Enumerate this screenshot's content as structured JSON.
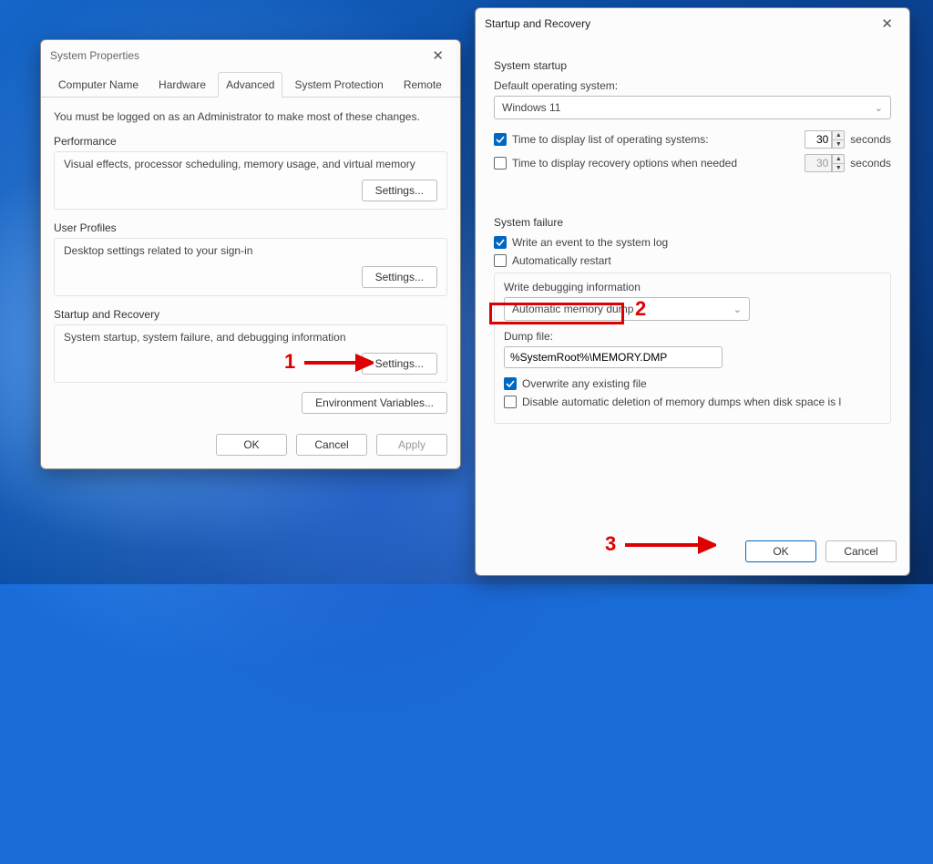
{
  "props": {
    "title": "System Properties",
    "tabs": [
      "Computer Name",
      "Hardware",
      "Advanced",
      "System Protection",
      "Remote"
    ],
    "active_tab": "Advanced",
    "admin_note": "You must be logged on as an Administrator to make most of these changes.",
    "perf": {
      "label": "Performance",
      "desc": "Visual effects, processor scheduling, memory usage, and virtual memory",
      "btn": "Settings..."
    },
    "profiles": {
      "label": "User Profiles",
      "desc": "Desktop settings related to your sign-in",
      "btn": "Settings..."
    },
    "startup": {
      "label": "Startup and Recovery",
      "desc": "System startup, system failure, and debugging information",
      "btn": "Settings..."
    },
    "env_btn": "Environment Variables...",
    "ok": "OK",
    "cancel": "Cancel",
    "apply": "Apply"
  },
  "sr": {
    "title": "Startup and Recovery",
    "startup_section": "System startup",
    "default_os_label": "Default operating system:",
    "default_os_value": "Windows 11",
    "time_os_label": "Time to display list of operating systems:",
    "time_os_value": "30",
    "time_os_checked": true,
    "time_rec_label": "Time to display recovery options when needed",
    "time_rec_value": "30",
    "time_rec_checked": false,
    "seconds": "seconds",
    "failure_section": "System failure",
    "write_event": "Write an event to the system log",
    "write_event_checked": true,
    "auto_restart": "Automatically restart",
    "auto_restart_checked": false,
    "debug_label": "Write debugging information",
    "dump_type": "Automatic memory dump",
    "dump_file_label": "Dump file:",
    "dump_file_value": "%SystemRoot%\\MEMORY.DMP",
    "overwrite": "Overwrite any existing file",
    "overwrite_checked": true,
    "disable_delete": "Disable automatic deletion of memory dumps when disk space is l",
    "disable_delete_checked": false,
    "ok": "OK",
    "cancel": "Cancel"
  },
  "anno": {
    "n1": "1",
    "n2": "2",
    "n3": "3"
  }
}
